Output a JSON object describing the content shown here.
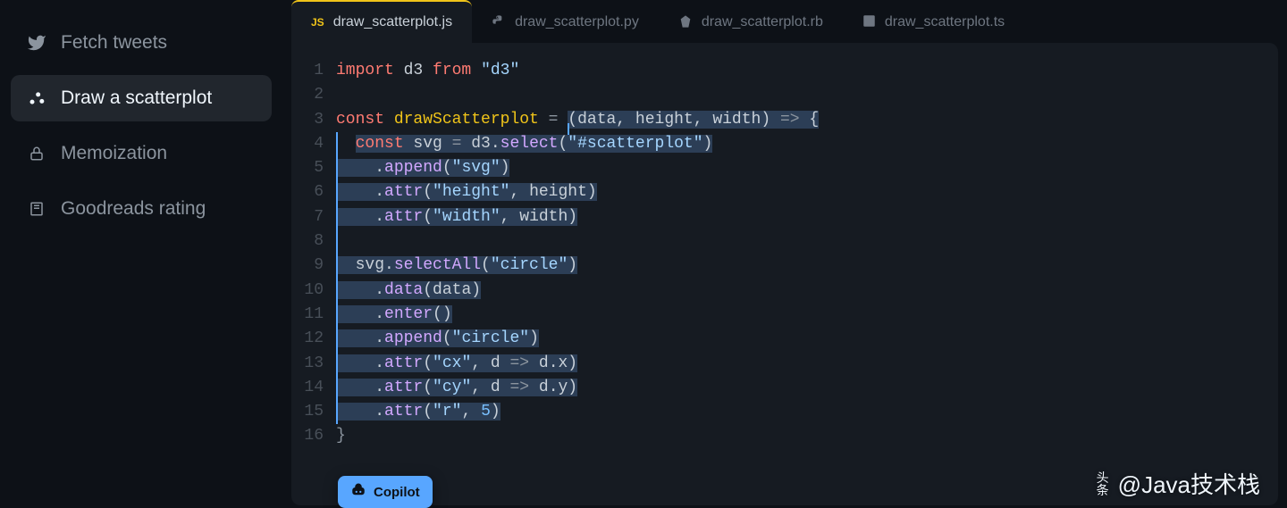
{
  "sidebar": {
    "items": [
      {
        "label": "Fetch tweets",
        "icon": "twitter-icon",
        "active": false
      },
      {
        "label": "Draw a scatterplot",
        "icon": "scatter-icon",
        "active": true
      },
      {
        "label": "Memoization",
        "icon": "lock-icon",
        "active": false
      },
      {
        "label": "Goodreads rating",
        "icon": "book-icon",
        "active": false
      }
    ]
  },
  "tabs": [
    {
      "label": "draw_scatterplot.js",
      "lang": "JS",
      "active": true
    },
    {
      "label": "draw_scatterplot.py",
      "lang": "PY",
      "active": false
    },
    {
      "label": "draw_scatterplot.rb",
      "lang": "RB",
      "active": false
    },
    {
      "label": "draw_scatterplot.ts",
      "lang": "TS",
      "active": false
    }
  ],
  "code": {
    "lines": [
      {
        "n": 1,
        "tokens": [
          [
            "kw",
            "import"
          ],
          [
            "pl",
            " d3 "
          ],
          [
            "kw",
            "from"
          ],
          [
            "pl",
            " "
          ],
          [
            "str",
            "\"d3\""
          ]
        ]
      },
      {
        "n": 2,
        "tokens": []
      },
      {
        "n": 3,
        "cursor": true,
        "tokens": [
          [
            "kw",
            "const"
          ],
          [
            "pl",
            " "
          ],
          [
            "yel",
            "drawScatterplot"
          ],
          [
            "pl",
            " "
          ],
          [
            "faded",
            "="
          ],
          [
            "pl",
            " "
          ]
        ],
        "after_cursor": [
          [
            "sel",
            "(data, height, width) "
          ],
          [
            "faded sel",
            "=>"
          ],
          [
            "sel",
            " {"
          ]
        ]
      },
      {
        "n": 4,
        "hl": true,
        "tokens": [
          [
            "pl",
            "  "
          ],
          [
            "kw sel",
            "const"
          ],
          [
            "pl sel",
            " svg "
          ],
          [
            "faded sel",
            "="
          ],
          [
            "pl sel",
            " d3."
          ],
          [
            "fn sel",
            "select"
          ],
          [
            "pl sel",
            "("
          ],
          [
            "str sel",
            "\"#scatterplot\""
          ],
          [
            "pl sel",
            ")"
          ]
        ]
      },
      {
        "n": 5,
        "hl": true,
        "tokens": [
          [
            "sel",
            "    ."
          ],
          [
            "fn sel",
            "append"
          ],
          [
            "sel",
            "("
          ],
          [
            "str sel",
            "\"svg\""
          ],
          [
            "sel",
            ")"
          ]
        ]
      },
      {
        "n": 6,
        "hl": true,
        "tokens": [
          [
            "sel",
            "    ."
          ],
          [
            "fn sel",
            "attr"
          ],
          [
            "sel",
            "("
          ],
          [
            "str sel",
            "\"height\""
          ],
          [
            "sel",
            ", height)"
          ]
        ]
      },
      {
        "n": 7,
        "hl": true,
        "tokens": [
          [
            "sel",
            "    ."
          ],
          [
            "fn sel",
            "attr"
          ],
          [
            "sel",
            "("
          ],
          [
            "str sel",
            "\"width\""
          ],
          [
            "sel",
            ", width)"
          ]
        ]
      },
      {
        "n": 8,
        "hl": true,
        "tokens": []
      },
      {
        "n": 9,
        "hl": true,
        "tokens": [
          [
            "sel",
            "  svg."
          ],
          [
            "fn sel",
            "selectAll"
          ],
          [
            "sel",
            "("
          ],
          [
            "str sel",
            "\"circle\""
          ],
          [
            "sel",
            ")"
          ]
        ]
      },
      {
        "n": 10,
        "hl": true,
        "tokens": [
          [
            "sel",
            "    ."
          ],
          [
            "fn sel",
            "data"
          ],
          [
            "sel",
            "(data)"
          ]
        ]
      },
      {
        "n": 11,
        "hl": true,
        "tokens": [
          [
            "sel",
            "    ."
          ],
          [
            "fn sel",
            "enter"
          ],
          [
            "sel",
            "()"
          ]
        ]
      },
      {
        "n": 12,
        "hl": true,
        "tokens": [
          [
            "sel",
            "    ."
          ],
          [
            "fn sel",
            "append"
          ],
          [
            "sel",
            "("
          ],
          [
            "str sel",
            "\"circle\""
          ],
          [
            "sel",
            ")"
          ]
        ]
      },
      {
        "n": 13,
        "hl": true,
        "tokens": [
          [
            "sel",
            "    ."
          ],
          [
            "fn sel",
            "attr"
          ],
          [
            "sel",
            "("
          ],
          [
            "str sel",
            "\"cx\""
          ],
          [
            "sel",
            ", d "
          ],
          [
            "faded sel",
            "=>"
          ],
          [
            "sel",
            " d.x)"
          ]
        ]
      },
      {
        "n": 14,
        "hl": true,
        "tokens": [
          [
            "sel",
            "    ."
          ],
          [
            "fn sel",
            "attr"
          ],
          [
            "sel",
            "("
          ],
          [
            "str sel",
            "\"cy\""
          ],
          [
            "sel",
            ", d "
          ],
          [
            "faded sel",
            "=>"
          ],
          [
            "sel",
            " d.y)"
          ]
        ]
      },
      {
        "n": 15,
        "hl": true,
        "tokens": [
          [
            "sel",
            "    ."
          ],
          [
            "fn sel",
            "attr"
          ],
          [
            "sel",
            "("
          ],
          [
            "str sel",
            "\"r\""
          ],
          [
            "sel",
            ", "
          ],
          [
            "num sel",
            "5"
          ],
          [
            "sel",
            ")"
          ]
        ]
      },
      {
        "n": 16,
        "tokens": [
          [
            "faded",
            "}"
          ]
        ]
      }
    ]
  },
  "copilot": {
    "label": "Copilot"
  },
  "watermark": {
    "prefix": "头条",
    "text": "@Java技术栈"
  }
}
